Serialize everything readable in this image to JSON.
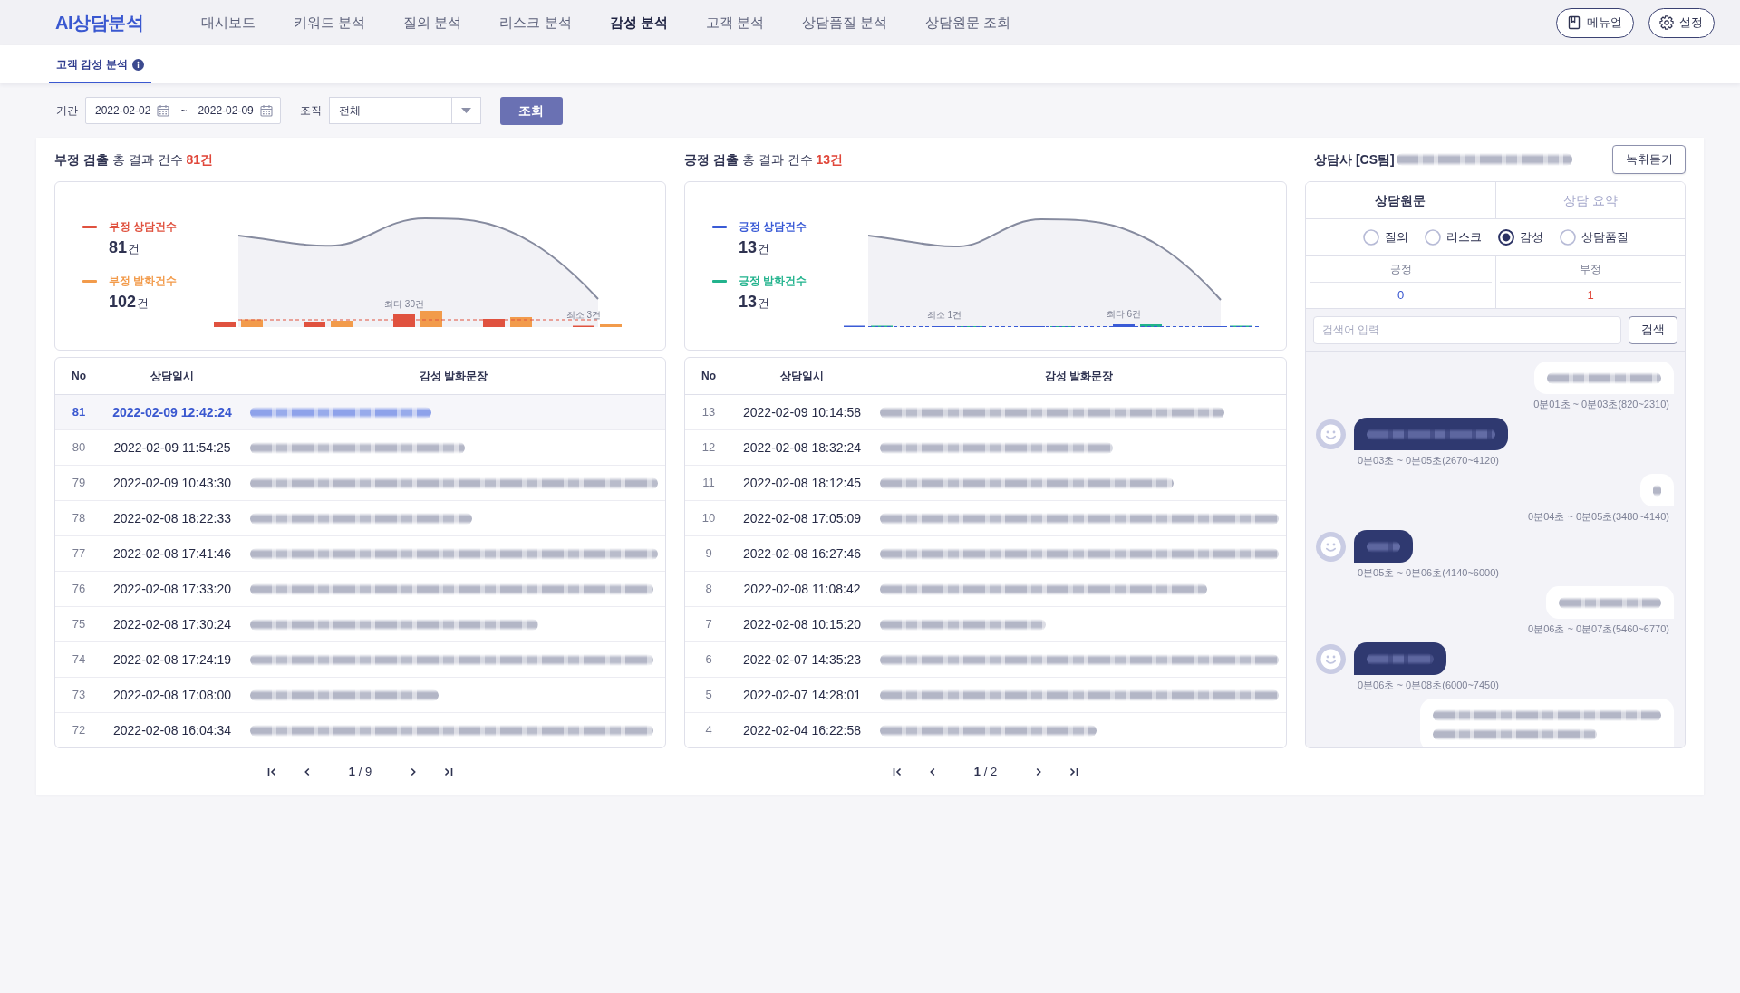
{
  "header": {
    "logo": "AI상담분석",
    "nav": [
      {
        "label": "대시보드",
        "selected": false
      },
      {
        "label": "키워드 분석",
        "selected": false
      },
      {
        "label": "질의 분석",
        "selected": false
      },
      {
        "label": "리스크 분석",
        "selected": false
      },
      {
        "label": "감성 분석",
        "selected": true
      },
      {
        "label": "고객 분석",
        "selected": false
      },
      {
        "label": "상담품질 분석",
        "selected": false
      },
      {
        "label": "상담원문 조회",
        "selected": false
      }
    ],
    "actions": [
      {
        "kind": "manual",
        "label": "메뉴얼"
      },
      {
        "kind": "settings",
        "label": "설정"
      }
    ]
  },
  "subtabs": [
    {
      "label": "고객 감성 분석",
      "selected": true
    }
  ],
  "filters": {
    "period_label": "기간",
    "date_from": "2022-02-02",
    "separator": "~",
    "date_to": "2022-02-09",
    "org_label": "조직",
    "org_value": "전체",
    "submit_button": "조회"
  },
  "panels": [
    {
      "title": "**부정 검출** 총 결과 건수",
      "total": "81건",
      "legend": [
        {
          "label": "부정 상담건수",
          "color": "#e0523f",
          "value": "81",
          "unit": "건"
        },
        {
          "label": "부정 발화건수",
          "color": "#f29b4b",
          "value": "102",
          "unit": "건"
        }
      ],
      "annotations": [
        "최다 30건",
        "최소 3건"
      ],
      "columns": [
        "No",
        "상담일시",
        "감성 발화문장"
      ],
      "rows": [
        {
          "no": "81",
          "datetime": "2022-02-09 12:42:24",
          "selected": true
        },
        {
          "no": "80",
          "datetime": "2022-02-09 11:54:25",
          "selected": false
        },
        {
          "no": "79",
          "datetime": "2022-02-09 10:43:30",
          "selected": false
        },
        {
          "no": "78",
          "datetime": "2022-02-08 18:22:33",
          "selected": false
        },
        {
          "no": "77",
          "datetime": "2022-02-08 17:41:46",
          "selected": false
        },
        {
          "no": "76",
          "datetime": "2022-02-08 17:33:20",
          "selected": false
        },
        {
          "no": "75",
          "datetime": "2022-02-08 17:30:24",
          "selected": false
        },
        {
          "no": "74",
          "datetime": "2022-02-08 17:24:19",
          "selected": false
        },
        {
          "no": "73",
          "datetime": "2022-02-08 17:08:00",
          "selected": false
        },
        {
          "no": "72",
          "datetime": "2022-02-08 16:04:34",
          "selected": false
        }
      ],
      "pagination": "**1** / 9"
    },
    {
      "title": "**긍정 검출** 총 결과 건수",
      "total": "13건",
      "legend": [
        {
          "label": "긍정 상담건수",
          "color": "#3a5bd6",
          "value": "13",
          "unit": "건"
        },
        {
          "label": "긍정 발화건수",
          "color": "#22b38d",
          "value": "13",
          "unit": "건"
        }
      ],
      "annotations": [
        "최소 1건",
        "최다 6건"
      ],
      "columns": [
        "No",
        "상담일시",
        "감성 발화문장"
      ],
      "rows": [
        {
          "no": "13",
          "datetime": "2022-02-09 10:14:58",
          "selected": false
        },
        {
          "no": "12",
          "datetime": "2022-02-08 18:32:24",
          "selected": false
        },
        {
          "no": "11",
          "datetime": "2022-02-08 18:12:45",
          "selected": false
        },
        {
          "no": "10",
          "datetime": "2022-02-08 17:05:09",
          "selected": false
        },
        {
          "no": "9",
          "datetime": "2022-02-08 16:27:46",
          "selected": false
        },
        {
          "no": "8",
          "datetime": "2022-02-08 11:08:42",
          "selected": false
        },
        {
          "no": "7",
          "datetime": "2022-02-08 10:15:20",
          "selected": false
        },
        {
          "no": "6",
          "datetime": "2022-02-07 14:35:23",
          "selected": false
        },
        {
          "no": "5",
          "datetime": "2022-02-07 14:28:01",
          "selected": false
        },
        {
          "no": "4",
          "datetime": "2022-02-04 16:22:58",
          "selected": false
        }
      ],
      "pagination": "**1** / 2"
    }
  ],
  "detail": {
    "title": "상담사 [CS팀]",
    "listen_button": "녹취듣기",
    "tabs": [
      {
        "label": "상담원문",
        "selected": true
      },
      {
        "label": "상담 요약",
        "selected": false
      }
    ],
    "filters": [
      {
        "label": "질의",
        "selected": false
      },
      {
        "label": "리스크",
        "selected": false
      },
      {
        "label": "감성",
        "selected": true
      },
      {
        "label": "상담품질",
        "selected": false
      }
    ],
    "counts": [
      {
        "kind": "positive",
        "label": "긍정",
        "value": "0"
      },
      {
        "kind": "negative",
        "label": "부정",
        "value": "1"
      }
    ],
    "search": {
      "placeholder": "검색어 입력",
      "button": "검색"
    },
    "messages": [
      {
        "kind": "agent",
        "time": "0분01초 ~ 0분03초(820~2310)"
      },
      {
        "kind": "customer",
        "time": "0분03초 ~ 0분05초(2670~4120)"
      },
      {
        "kind": "agent",
        "time": "0분04초 ~ 0분05초(3480~4140)"
      },
      {
        "kind": "customer",
        "time": "0분05초 ~ 0분06초(4140~6000)"
      },
      {
        "kind": "agent",
        "time": "0분06초 ~ 0분07초(5460~6770)"
      },
      {
        "kind": "customer",
        "time": "0분06초 ~ 0분08초(6000~7450)"
      },
      {
        "kind": "agent"
      }
    ]
  }
}
